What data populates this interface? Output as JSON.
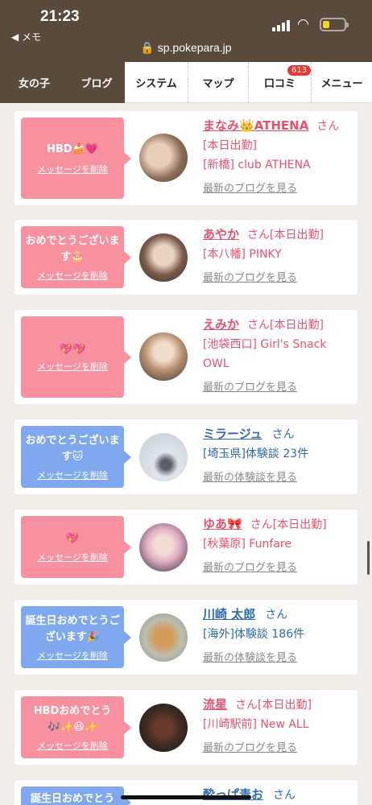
{
  "status_bar": {
    "time": "21:23",
    "back_label": "◀ メモ",
    "url": "sp.pokepara.jp"
  },
  "nav": {
    "tabs": [
      {
        "label": "女の子"
      },
      {
        "label": "ブログ"
      },
      {
        "label": "システム"
      },
      {
        "label": "マップ"
      },
      {
        "label": "口コミ",
        "badge": "613"
      },
      {
        "label": "メニュー"
      }
    ]
  },
  "cards": [
    {
      "message": "HBD🍰💗",
      "delete_label": "メッセージを削除",
      "name": "まなみ👑ATHENA",
      "suffix": "さん",
      "line1": "[本日出勤]",
      "line2": "[新橋] club ATHENA",
      "link": "最新のブログを見る",
      "avatar": "avatar-photo"
    },
    {
      "message": "おめでとうございます🎂",
      "delete_label": "メッセージを削除",
      "name": "あやか",
      "suffix": "さん[本日出勤]",
      "line1": "[本八幡] PINKY",
      "link": "最新のブログを見る",
      "avatar": "avatar-photo"
    },
    {
      "message": "💖💖",
      "delete_label": "メッセージを削除",
      "name": "えみか",
      "suffix": "さん[本日出勤]",
      "line1": "[池袋西口] Girl's Snack OWL",
      "link": "最新のブログを見る",
      "avatar": "avatar-photo"
    },
    {
      "message": "おめでとうございます🐱",
      "delete_label": "メッセージを削除",
      "name": "ミラージュ",
      "suffix": "さん",
      "line1": "[埼玉県]体験談 23件",
      "link": "最新の体験談を見る",
      "avatar": "avatar-photo"
    },
    {
      "message": "💖",
      "delete_label": "メッセージを削除",
      "name": "ゆあ🎀",
      "suffix": "さん[本日出勤]",
      "line1": "[秋葉原] Funfare",
      "link": "最新のブログを見る",
      "avatar": "avatar-photo"
    },
    {
      "message": "誕生日おめでとうございます🎉",
      "delete_label": "メッセージを削除",
      "name": "川崎 太郎",
      "suffix": "さん",
      "line1": "[海外]体験談 186件",
      "link": "最新の体験談を見る",
      "avatar": "avatar-photo"
    },
    {
      "message": "HBDおめでとう🎶✨😆✨",
      "delete_label": "メッセージを削除",
      "name": "流星",
      "suffix": "さん[本日出勤]",
      "line1": "[川崎駅前] New ALL",
      "link": "最新のブログを見る",
      "avatar": "avatar-photo"
    },
    {
      "message": "誕生日おめでとう",
      "name": "酔っぱ毒お",
      "suffix": "さん"
    }
  ],
  "colors": {
    "header": "#5a4a3c",
    "pink_bubble": "#f8919f",
    "blue_bubble": "#7fa8ee",
    "pink_text": "#e8516e",
    "blue_text": "#2d6aad"
  }
}
